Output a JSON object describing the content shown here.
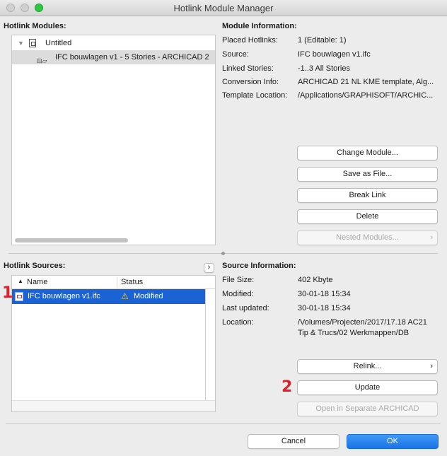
{
  "window": {
    "title": "Hotlink Module Manager"
  },
  "hotlink_modules": {
    "title": "Hotlink Modules:",
    "tree": [
      {
        "label": "Untitled",
        "icon": "document-icon"
      },
      {
        "label": "IFC bouwlagen v1 - 5 Stories - ARCHICAD 2",
        "icon": "module-icon"
      }
    ]
  },
  "module_info": {
    "title": "Module Information:",
    "rows": [
      {
        "label": "Placed Hotlinks:",
        "value": "1 (Editable: 1)"
      },
      {
        "label": "Source:",
        "value": "IFC bouwlagen v1.ifc"
      },
      {
        "label": "Linked Stories:",
        "value": "-1..3 All Stories"
      },
      {
        "label": "Conversion Info:",
        "value": "ARCHICAD 21 NL KME template, Alg..."
      },
      {
        "label": "Template Location:",
        "value": "/Applications/GRAPHISOFT/ARCHIC..."
      }
    ],
    "buttons": {
      "change": "Change Module...",
      "save": "Save as File...",
      "break": "Break Link",
      "delete": "Delete",
      "nested": "Nested Modules..."
    }
  },
  "hotlink_sources": {
    "title": "Hotlink Sources:",
    "col_name": "Name",
    "col_status": "Status",
    "rows": [
      {
        "name": "IFC bouwlagen v1.ifc",
        "status": "Modified"
      }
    ]
  },
  "source_info": {
    "title": "Source Information:",
    "rows": [
      {
        "label": "File Size:",
        "value": "402 Kbyte"
      },
      {
        "label": "Modified:",
        "value": "30-01-18 15:34"
      },
      {
        "label": "Last updated:",
        "value": "30-01-18 15:34"
      },
      {
        "label": "Location:",
        "value": "/Volumes/Projecten/2017/17.18 AC21",
        "value2": "Tip & Trucs/02 Werkmappen/DB"
      }
    ],
    "buttons": {
      "relink": "Relink...",
      "update": "Update",
      "open": "Open in Separate ARCHICAD"
    }
  },
  "annotations": {
    "one": "1",
    "two": "2"
  },
  "footer": {
    "cancel": "Cancel",
    "ok": "OK"
  },
  "colors": {
    "accent": "#1b62d4",
    "annotation": "#e0212b"
  }
}
